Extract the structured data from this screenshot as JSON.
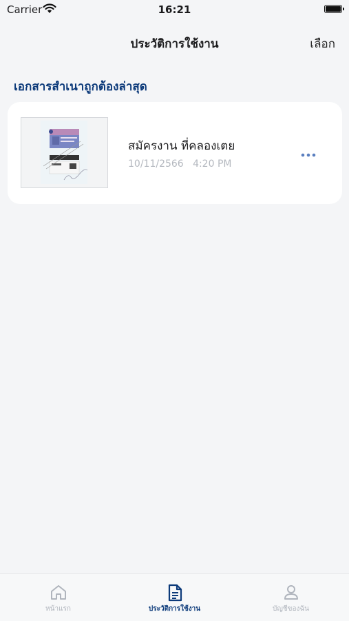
{
  "status_bar": {
    "carrier": "Carrier",
    "time": "16:21"
  },
  "nav": {
    "title": "ประวัติการใช้งาน",
    "select_label": "เลือก"
  },
  "section": {
    "title": "เอกสารสำเนาถูกต้องล่าสุด"
  },
  "documents": [
    {
      "title": "สมัครงาน ที่คลองเตย",
      "date": "10/11/2566",
      "time": "4:20 PM",
      "more_icon": "more-horizontal-icon"
    }
  ],
  "tabs": [
    {
      "label": "หน้าแรก",
      "icon": "home-icon",
      "active": false
    },
    {
      "label": "ประวัติการใช้งาน",
      "icon": "document-icon",
      "active": true
    },
    {
      "label": "บัญชีของฉัน",
      "icon": "user-icon",
      "active": false
    }
  ],
  "colors": {
    "accent": "#0c3a7a",
    "background": "#f4f5f7",
    "muted": "#b4b8bf",
    "more": "#5a7fbf"
  }
}
